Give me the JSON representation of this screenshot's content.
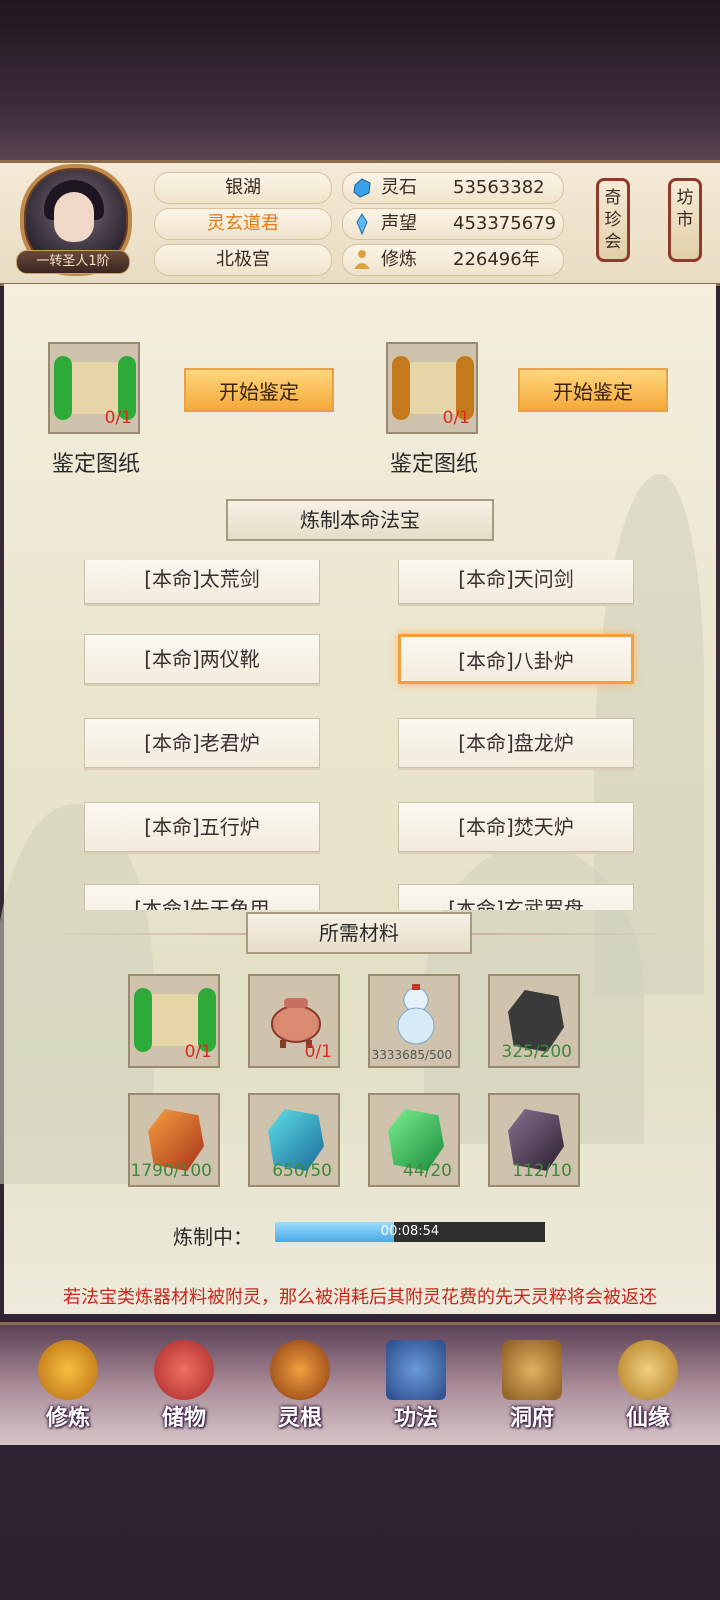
{
  "header": {
    "rank": "一转圣人1阶",
    "names": [
      "银湖",
      "灵玄道君",
      "北极宫"
    ],
    "resources": [
      {
        "label": "灵石",
        "value": "53563382",
        "icon": "spirit-stone-icon"
      },
      {
        "label": "声望",
        "value": "453375679",
        "icon": "prestige-icon"
      },
      {
        "label": "修炼",
        "value": "226496年",
        "icon": "meditation-icon"
      }
    ],
    "shops": [
      "奇珍会",
      "坊市"
    ]
  },
  "identify": [
    {
      "count": "0/1",
      "label": "鉴定图纸",
      "button": "开始鉴定"
    },
    {
      "count": "0/1",
      "label": "鉴定图纸",
      "button": "开始鉴定"
    }
  ],
  "refine_title": "炼制本命法宝",
  "artifacts": [
    "[本命]太荒剑",
    "[本命]天问剑",
    "[本命]两仪靴",
    "[本命]八卦炉",
    "[本命]老君炉",
    "[本命]盘龙炉",
    "[本命]五行炉",
    "[本命]焚天炉",
    "[本命]先天龟甲",
    "[本命]玄武罗盘"
  ],
  "materials_title": "所需材料",
  "materials": [
    {
      "icon": "scroll-icon",
      "count": "0/1"
    },
    {
      "icon": "incense-burner-icon",
      "count": "0/1"
    },
    {
      "icon": "gourd-vase-icon",
      "count": "3333685/500"
    },
    {
      "icon": "rune-stone-icon",
      "count": "325/200"
    },
    {
      "icon": "fire-crystal-icon",
      "count": "1790/100"
    },
    {
      "icon": "blue-crystal-icon",
      "count": "650/50"
    },
    {
      "icon": "green-crystal-icon",
      "count": "44/20"
    },
    {
      "icon": "purple-crystal-icon",
      "count": "112/10"
    }
  ],
  "progress": {
    "label": "炼制中：",
    "time": "00:08:54",
    "fraction": 0.44
  },
  "notice": "若法宝类炼器材料被附灵，那么被消耗后其附灵花费的先天灵粹将会被返还",
  "nav": [
    "修炼",
    "储物",
    "灵根",
    "功法",
    "洞府",
    "仙缘"
  ],
  "colors": {
    "accent": "#f5a83a",
    "warning": "#c7261c",
    "ok": "#3c8a3a"
  }
}
